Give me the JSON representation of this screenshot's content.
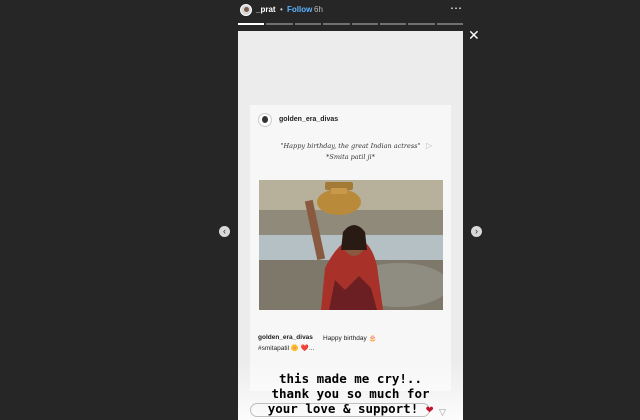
{
  "header": {
    "username": "_prat",
    "separator": "•",
    "follow_label": "Follow",
    "time": "6h",
    "more_icon": "⋯"
  },
  "progress": {
    "segments": 8,
    "current": 1
  },
  "close_icon": "✕",
  "nav": {
    "prev_icon": "‹",
    "next_icon": "›"
  },
  "post": {
    "username": "golden_era_divas",
    "quote_line1": "\"Happy birthday, the great Indian actress\"",
    "quote_line2": "*Smita patil ji*",
    "caption_user": "golden_era_divas",
    "caption_text": "Happy birthday 🎂",
    "caption_tag": "#smitapatil 🌼 ❤️..."
  },
  "story_caption": {
    "line1": "this made me cry!..",
    "line2": "thank you so much for",
    "line3": "your love & support!",
    "emoji": "❤"
  },
  "send_icon": "▽",
  "colors": {
    "background": "#262626",
    "follow": "#5db3ff",
    "heart": "#c0122a"
  }
}
